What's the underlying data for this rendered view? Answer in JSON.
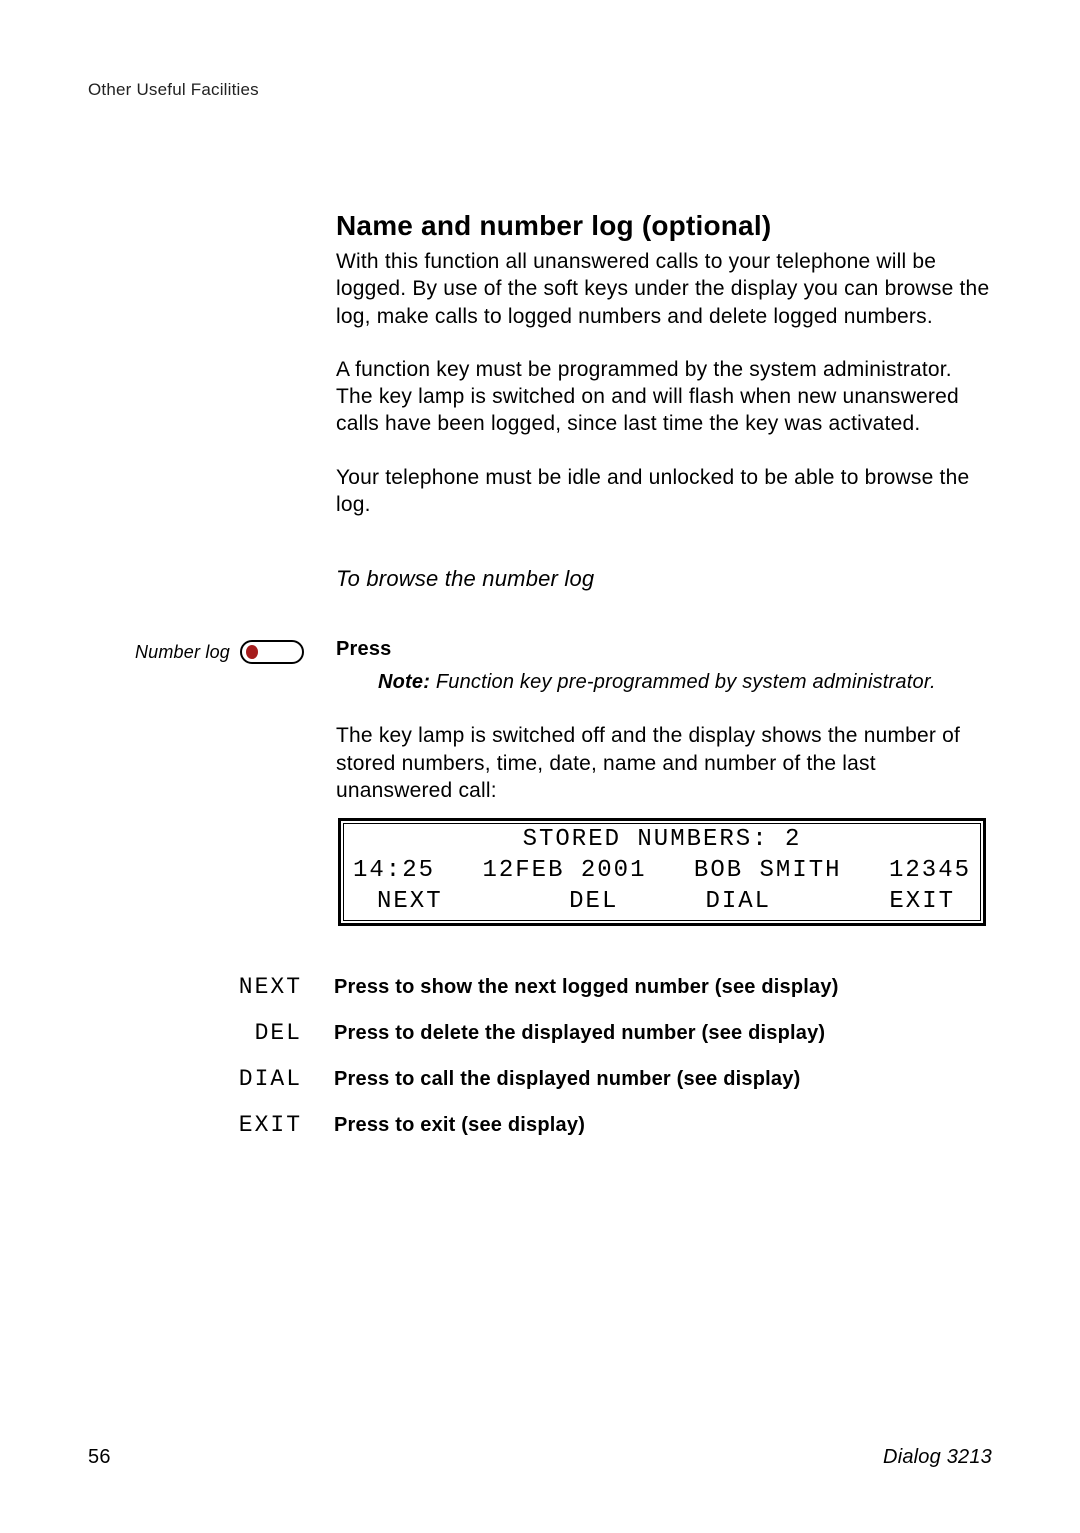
{
  "header": {
    "section_label": "Other Useful Facilities"
  },
  "section": {
    "title": "Name and number log (optional)",
    "p1": "With this function all unanswered calls to your telephone will be logged. By use of the soft keys under the display you can browse the log, make calls to logged numbers and delete logged numbers.",
    "p2": "A function key must be programmed by the system administrator. The key lamp is switched on and will flash when new unanswered calls have been logged, since last time the key was activated.",
    "p3": "Your telephone must be idle and unlocked to be able to browse the log.",
    "subheading": "To browse the number log"
  },
  "key_row": {
    "label": "Number log",
    "action": "Press",
    "note_label": "Note:",
    "note_text": " Function key pre-programmed by system administrator."
  },
  "after_note": "The key lamp is switched off and the display shows the number of stored numbers, time, date, name and number of the last unanswered call:",
  "display": {
    "line1": "STORED NUMBERS: 2",
    "time": "14:25",
    "date": "12FEB 2001",
    "name": "BOB SMITH",
    "number": "12345",
    "sk1": "NEXT",
    "sk2": "DEL",
    "sk3": "DIAL",
    "sk4": "EXIT"
  },
  "softkeys": [
    {
      "label": "NEXT",
      "text": "Press to show the next logged number (see display)"
    },
    {
      "label": "DEL",
      "text": "Press to delete the displayed number (see display)"
    },
    {
      "label": "DIAL",
      "text": "Press to call the displayed number (see display)"
    },
    {
      "label": "EXIT",
      "text": "Press to exit (see display)"
    }
  ],
  "footer": {
    "page_number": "56",
    "model": "Dialog 3213"
  }
}
